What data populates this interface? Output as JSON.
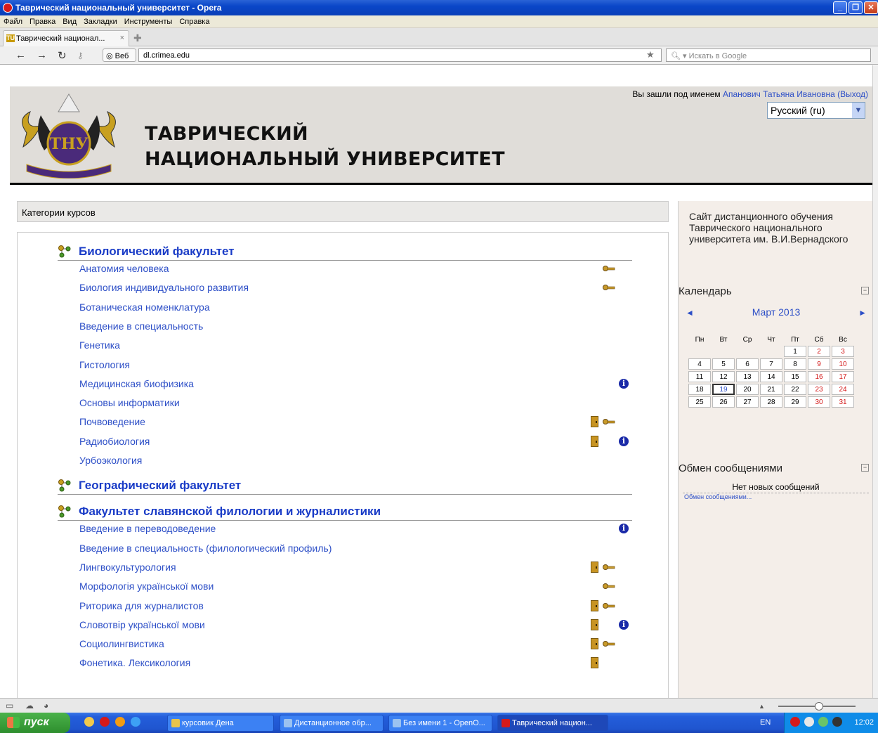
{
  "window": {
    "title": "Таврический национальный университет - Opera"
  },
  "menubar": [
    "Файл",
    "Правка",
    "Вид",
    "Закладки",
    "Инструменты",
    "Справка"
  ],
  "tab": {
    "label": "Таврический национал...",
    "close": "×",
    "favicon": "TU"
  },
  "addressbar": {
    "web_label": "Веб",
    "url": "dl.crimea.edu",
    "search_placeholder": "Искать в Google"
  },
  "header": {
    "university_line1": "ТАВРИЧЕСКИЙ",
    "university_line2": "НАЦИОНАЛЬНЫЙ УНИВЕРСИТЕТ",
    "login_prefix": "Вы зашли под именем",
    "user_name": "Апанович Татьяна Ивановна",
    "logout": "(Выход)",
    "language": "Русский (ru)"
  },
  "categories": {
    "header": "Категории курсов",
    "list": [
      {
        "name": "Биологический факультет",
        "courses": [
          {
            "name": "Анатомия человека",
            "door": false,
            "key": true,
            "info": false
          },
          {
            "name": "Биология индивидуального развития",
            "door": false,
            "key": true,
            "info": false
          },
          {
            "name": "Ботаническая номенклатура",
            "door": false,
            "key": false,
            "info": false
          },
          {
            "name": "Введение в специальность",
            "door": false,
            "key": false,
            "info": false
          },
          {
            "name": "Генетика",
            "door": false,
            "key": false,
            "info": false
          },
          {
            "name": "Гистология",
            "door": false,
            "key": false,
            "info": false
          },
          {
            "name": "Медицинская биофизика",
            "door": false,
            "key": false,
            "info": true
          },
          {
            "name": "Основы информатики",
            "door": false,
            "key": false,
            "info": false
          },
          {
            "name": "Почвоведение",
            "door": true,
            "key": true,
            "info": false
          },
          {
            "name": "Радиобиология",
            "door": true,
            "key": false,
            "info": true
          },
          {
            "name": "Урбоэкология",
            "door": false,
            "key": false,
            "info": false
          }
        ]
      },
      {
        "name": "Географический факультет",
        "courses": []
      },
      {
        "name": "Факультет славянской филологии и журналистики",
        "courses": [
          {
            "name": "Введение в переводоведение",
            "door": false,
            "key": false,
            "info": true
          },
          {
            "name": "Введение в специальность (филологический профиль)",
            "door": false,
            "key": false,
            "info": false
          },
          {
            "name": "Лингвокультурология",
            "door": true,
            "key": true,
            "info": false
          },
          {
            "name": "Морфологія української мови",
            "door": false,
            "key": true,
            "info": false
          },
          {
            "name": "Риторика для журналистов",
            "door": true,
            "key": true,
            "info": false
          },
          {
            "name": "Словотвір української мови",
            "door": true,
            "key": false,
            "info": true
          },
          {
            "name": "Социолингвистика",
            "door": true,
            "key": true,
            "info": false
          },
          {
            "name": "Фонетика. Лексикология",
            "door": true,
            "key": false,
            "info": false
          }
        ]
      }
    ]
  },
  "sidebar": {
    "site_description": "Сайт дистанционного обучения Таврического национального университета им. В.И.Вернадского",
    "calendar": {
      "title": "Календарь",
      "month": "Март 2013",
      "prev": "◄",
      "next": "►",
      "weekdays": [
        "Пн",
        "Вт",
        "Ср",
        "Чт",
        "Пт",
        "Сб",
        "Вс"
      ],
      "weeks": [
        [
          "",
          "",
          "",
          "",
          "1",
          "2",
          "3"
        ],
        [
          "4",
          "5",
          "6",
          "7",
          "8",
          "9",
          "10"
        ],
        [
          "11",
          "12",
          "13",
          "14",
          "15",
          "16",
          "17"
        ],
        [
          "18",
          "19",
          "20",
          "21",
          "22",
          "23",
          "24"
        ],
        [
          "25",
          "26",
          "27",
          "28",
          "29",
          "30",
          "31"
        ]
      ],
      "today": "19"
    },
    "messages": {
      "title": "Обмен сообщениями",
      "empty": "Нет новых сообщений",
      "link": "Обмен сообщениями..."
    }
  },
  "taskbar": {
    "start": "пуск",
    "buttons": [
      {
        "label": "курсовик Дена",
        "color": "#e8c44a"
      },
      {
        "label": "Дистанционное обр...",
        "color": "#9bc2f0"
      },
      {
        "label": "Без имени 1 - OpenO...",
        "color": "#9bc2f0"
      },
      {
        "label": "Таврический национ...",
        "color": "#d61a1a"
      }
    ],
    "lang": "EN",
    "clock": "12:02"
  }
}
